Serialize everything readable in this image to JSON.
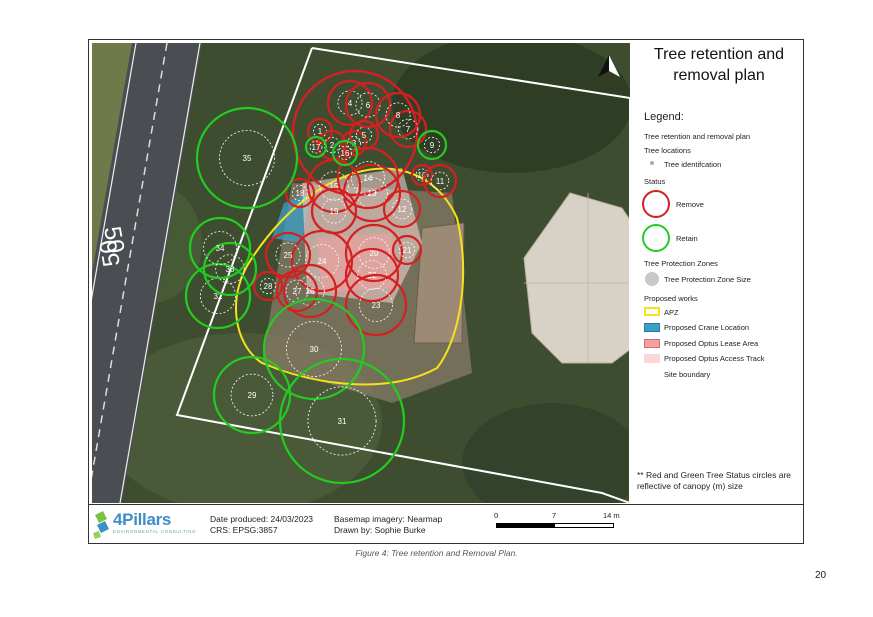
{
  "title": "Tree retention and removal plan",
  "legend": {
    "heading": "Legend:",
    "items": [
      {
        "key": "plan",
        "label": "Tree retention and removal plan"
      },
      {
        "key": "tree_locations",
        "label": "Tree locations"
      },
      {
        "key": "tree_id",
        "label": "Tree identifcation"
      },
      {
        "key": "status",
        "label": "Status"
      },
      {
        "key": "remove",
        "label": "Remove",
        "color": "#d42020"
      },
      {
        "key": "retain",
        "label": "Retain",
        "color": "#22cc22"
      },
      {
        "key": "tpz_head",
        "label": "Tree Protection Zones"
      },
      {
        "key": "tpz",
        "label": "Tree Protection Zone Size"
      },
      {
        "key": "works",
        "label": "Proposed works"
      },
      {
        "key": "apz",
        "label": "APZ",
        "color": "#f5e21a"
      },
      {
        "key": "crane",
        "label": "Proposed Crane Location",
        "color": "#3aa0c8"
      },
      {
        "key": "lease",
        "label": "Proposed Optus Lease Area",
        "color": "#f5a0a0"
      },
      {
        "key": "track",
        "label": "Proposed Optus Access Track",
        "color": "#fbd8d8"
      },
      {
        "key": "boundary",
        "label": "Site boundary"
      }
    ]
  },
  "note": "** Red and Green Tree Status circles are reflective of canopy (m) size",
  "footer": {
    "logo_text": "4Pillars",
    "logo_sub": "ENVIRONMENTAL CONSULTING",
    "date": "Date produced: 24/03/2023",
    "crs": "CRS: EPSG:3857",
    "basemap": "Basemap imagery: Nearmap",
    "drawn": "Drawn by: Sophie Burke",
    "scale_labels": [
      "0",
      "7",
      "14 m"
    ]
  },
  "road_markings": [
    "50",
    "50"
  ],
  "trees": [
    {
      "id": "1",
      "status": "remove"
    },
    {
      "id": "2",
      "status": "remove"
    },
    {
      "id": "3",
      "status": "remove"
    },
    {
      "id": "4",
      "status": "remove"
    },
    {
      "id": "5",
      "status": "remove"
    },
    {
      "id": "6",
      "status": "remove"
    },
    {
      "id": "7",
      "status": "remove"
    },
    {
      "id": "8",
      "status": "remove"
    },
    {
      "id": "9",
      "status": "retain"
    },
    {
      "id": "10",
      "status": "remove"
    },
    {
      "id": "11",
      "status": "remove"
    },
    {
      "id": "12",
      "status": "remove"
    },
    {
      "id": "13",
      "status": "remove"
    },
    {
      "id": "14",
      "status": "remove"
    },
    {
      "id": "15",
      "status": "remove"
    },
    {
      "id": "16",
      "status": "retain"
    },
    {
      "id": "17",
      "status": "retain"
    },
    {
      "id": "18",
      "status": "remove"
    },
    {
      "id": "19",
      "status": "remove"
    },
    {
      "id": "20",
      "status": "remove"
    },
    {
      "id": "21",
      "status": "remove"
    },
    {
      "id": "22",
      "status": "remove"
    },
    {
      "id": "23",
      "status": "remove"
    },
    {
      "id": "24",
      "status": "remove"
    },
    {
      "id": "25",
      "status": "remove"
    },
    {
      "id": "26",
      "status": "remove"
    },
    {
      "id": "27",
      "status": "remove"
    },
    {
      "id": "28",
      "status": "remove"
    },
    {
      "id": "29",
      "status": "retain"
    },
    {
      "id": "30",
      "status": "retain"
    },
    {
      "id": "31",
      "status": "retain"
    },
    {
      "id": "32",
      "status": "retain"
    },
    {
      "id": "33",
      "status": "retain"
    },
    {
      "id": "34",
      "status": "retain"
    },
    {
      "id": "35",
      "status": "retain"
    }
  ],
  "caption": "Figure 4: Tree retention and Removal Plan.",
  "page_number": "20"
}
